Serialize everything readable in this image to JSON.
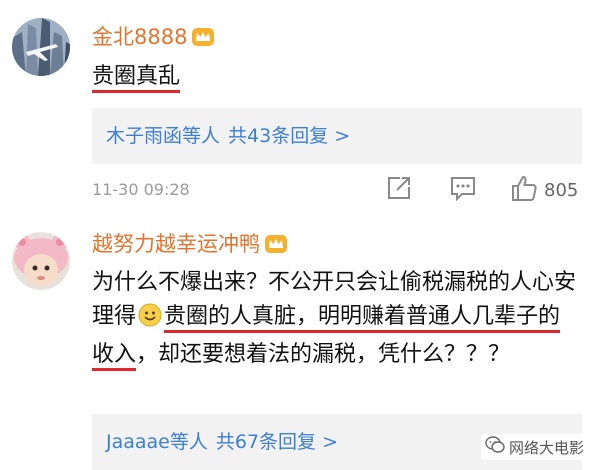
{
  "comments": [
    {
      "username": "金北8888",
      "text": "贵圈真乱",
      "replies": {
        "names": "木子雨函等人",
        "count_label": "共43条回复 >"
      },
      "timestamp": "11-30 09:28",
      "likes": "805"
    },
    {
      "username": "越努力越幸运冲鸭",
      "text_parts": [
        "为什么不爆出来？不公开只会让偷税漏税的人心安理得",
        "贵圈的人真脏，明明赚着普通人几辈子的收入",
        "，却还要想着法的漏税，凭什么？？？"
      ],
      "replies": {
        "names": "Jaaaae等人",
        "count_label": "共67条回复 >"
      }
    }
  ],
  "watermark": "网络大电影",
  "colors": {
    "username": "#e2742d",
    "link": "#3c7fd5",
    "underline": "#e0262c",
    "reply_bg": "#f2f2f2"
  }
}
